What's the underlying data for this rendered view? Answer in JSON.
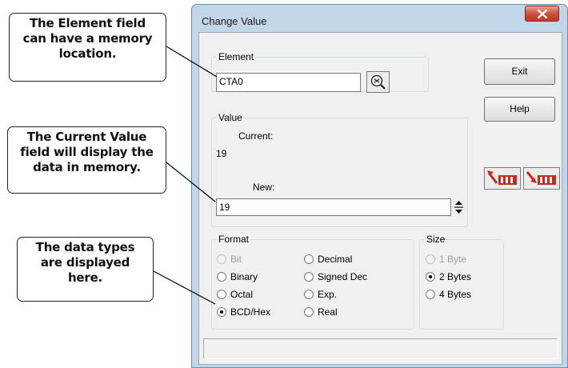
{
  "callouts": {
    "element": [
      "The Element field",
      "can have a memory",
      "location."
    ],
    "current": [
      "The Current Value",
      "field will display the",
      "data in memory."
    ],
    "types": [
      "The data types",
      "are displayed",
      "here."
    ]
  },
  "dialog": {
    "title": "Change Value",
    "element": {
      "label": "Element",
      "value": "CTA0"
    },
    "value": {
      "label": "Value",
      "current_label": "Current:",
      "current_value": "19",
      "new_label": "New:",
      "new_value": "19"
    },
    "format": {
      "label": "Format",
      "options": [
        {
          "label": "Bit",
          "enabled": false,
          "selected": false
        },
        {
          "label": "Binary",
          "enabled": true,
          "selected": false
        },
        {
          "label": "Octal",
          "enabled": true,
          "selected": false
        },
        {
          "label": "BCD/Hex",
          "enabled": true,
          "selected": true
        },
        {
          "label": "Decimal",
          "enabled": true,
          "selected": false
        },
        {
          "label": "Signed Dec",
          "enabled": true,
          "selected": false
        },
        {
          "label": "Exp.",
          "enabled": true,
          "selected": false
        },
        {
          "label": "Real",
          "enabled": true,
          "selected": false
        }
      ]
    },
    "size": {
      "label": "Size",
      "options": [
        {
          "label": "1 Byte",
          "enabled": false,
          "selected": false
        },
        {
          "label": "2 Bytes",
          "enabled": true,
          "selected": true
        },
        {
          "label": "4 Bytes",
          "enabled": true,
          "selected": false
        }
      ]
    },
    "buttons": {
      "exit": "Exit",
      "help": "Help"
    },
    "icons": {
      "lookup": "lookup-icon",
      "transfer_up": "transfer-up-icon",
      "transfer_down": "transfer-down-icon",
      "close": "close-icon"
    }
  }
}
